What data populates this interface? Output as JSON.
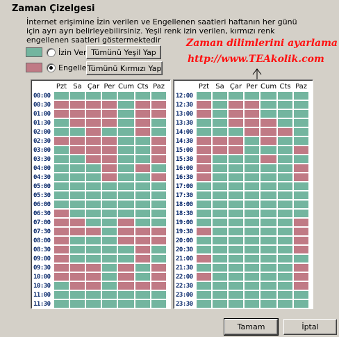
{
  "title": "Zaman Çizelgesi",
  "description": [
    "İnternet erişimine İzin verilen ve Engellenen saatleri haftanın her günü",
    "için ayrı ayrı belirleyebilirsiniz. Yeşil renk izin verilen, kırmızı renk",
    "engellenen saatleri göstermektedir"
  ],
  "colors": {
    "allow": "#73b59f",
    "block": "#c07a85"
  },
  "legend": {
    "allow": {
      "label": "İzin Ver",
      "checked": false
    },
    "block": {
      "label": "Engelle",
      "checked": true
    }
  },
  "buttons": {
    "all_green": "Tümünü Yeşil Yap",
    "all_red": "Tümünü Kırmızı Yap",
    "ok": "Tamam",
    "cancel": "İptal"
  },
  "annotation": {
    "line1": "Zaman dilimlerini ayarlama",
    "line2": "http://www.TEAkolik.com"
  },
  "days": [
    "Pzt",
    "Sa",
    "Çar",
    "Per",
    "Cum",
    "Cts",
    "Paz"
  ],
  "left_grid": {
    "times": [
      "00:00",
      "00:30",
      "01:00",
      "01:30",
      "02:00",
      "02:30",
      "03:00",
      "03:30",
      "04:00",
      "04:30",
      "05:00",
      "05:30",
      "06:00",
      "06:30",
      "07:00",
      "07:30",
      "08:00",
      "08:30",
      "09:00",
      "09:30",
      "10:00",
      "10:30",
      "11:00",
      "11:30"
    ],
    "rows": [
      "GGGGGGG",
      "RRRRGRR",
      "RRRRGRR",
      "GRRRGRG",
      "GGRGGRG",
      "RRRRGGR",
      "GRRRGGR",
      "GGRRGGR",
      "GGGRGRG",
      "GGGRGGR",
      "GGGGGGG",
      "GGGGGGG",
      "GGGGGGG",
      "RGGGGGG",
      "RRGGRGG",
      "RRRGRRR",
      "RGGGRRR",
      "RGGGGRG",
      "RGGGGRG",
      "RRRGRGR",
      "RRRGRGR",
      "GRRGRRR",
      "GGGGGGG",
      "GGGGGGG"
    ]
  },
  "right_grid": {
    "times": [
      "12:00",
      "12:30",
      "13:00",
      "13:30",
      "14:00",
      "14:30",
      "15:00",
      "15:30",
      "16:00",
      "16:30",
      "17:00",
      "17:30",
      "18:00",
      "18:30",
      "19:00",
      "19:30",
      "20:00",
      "20:30",
      "21:00",
      "21:30",
      "22:00",
      "22:30",
      "23:00",
      "23:30"
    ],
    "rows": [
      "GGGGGGG",
      "RGRRGGG",
      "RGRRGGG",
      "GGRRRGG",
      "GGGRRRG",
      "RRRGRGG",
      "RRRGGGR",
      "RGGGRGG",
      "RGGGGGR",
      "RGGGGGR",
      "GGGGGGG",
      "GGGGGGG",
      "GGGGGGG",
      "GGGGGGG",
      "GGGGGGR",
      "RGGGGGR",
      "GGGGGGR",
      "GGGGGGR",
      "RGGGGGG",
      "GGGGGGR",
      "RGGGGGR",
      "GGGGGGR",
      "GGGGGGG",
      "GGGGGGG"
    ]
  }
}
